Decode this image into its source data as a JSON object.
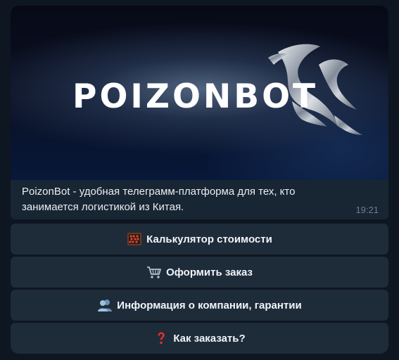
{
  "message": {
    "banner_title": "POIZONBOT",
    "caption": "PoizonBot - удобная телеграмм-платформа для тех, кто занимается логистикой из Китая.",
    "time": "19:21"
  },
  "keyboard": {
    "buttons": [
      {
        "label": "Калькулятор стоимости",
        "icon": "abacus-icon"
      },
      {
        "label": "Оформить заказ",
        "icon": "shopping-cart-icon"
      },
      {
        "label": "Информация о компании, гарантии",
        "icon": "busts-in-silhouette-icon"
      },
      {
        "label": "Как заказать?",
        "icon": "red-question-mark-icon"
      }
    ]
  },
  "colors": {
    "chat_background": "#0e1621",
    "message_background": "#182533",
    "button_background": "#1e2c3a",
    "caption_text": "#e9eef3",
    "time_text": "#6d7f8f"
  }
}
